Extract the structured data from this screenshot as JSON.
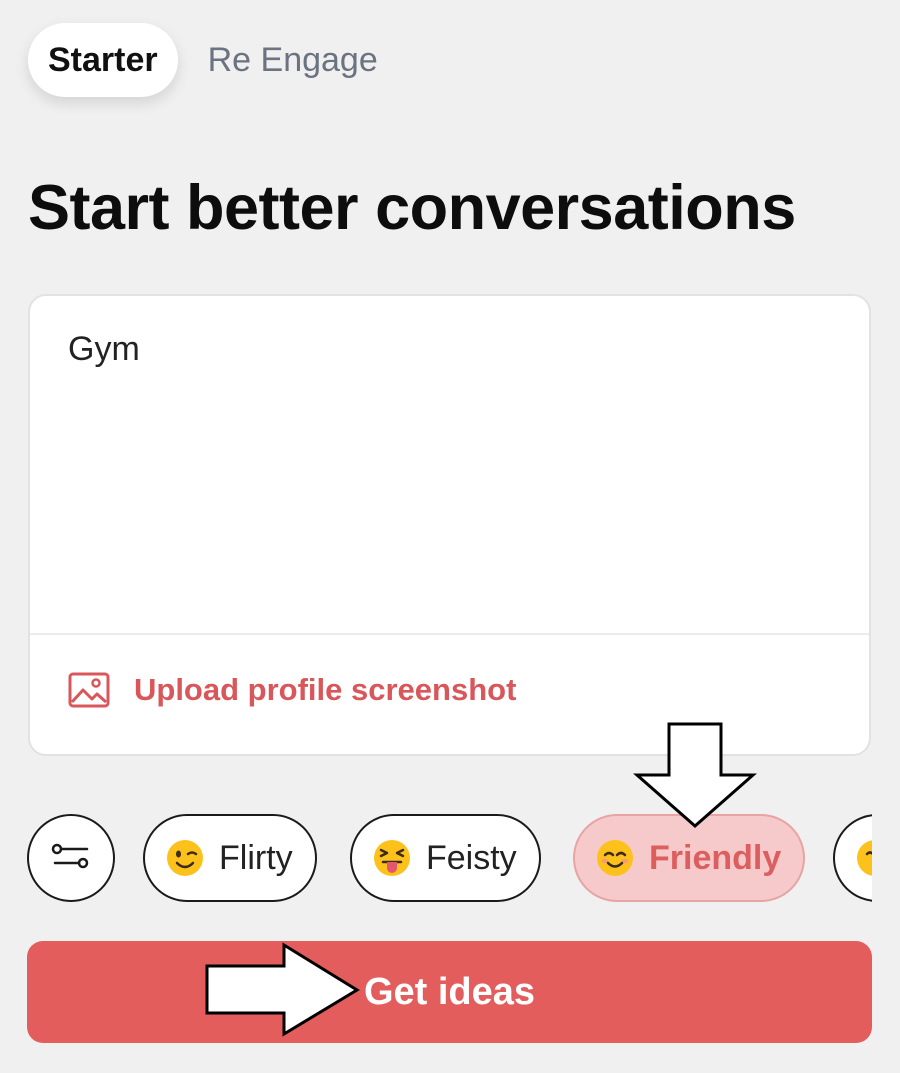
{
  "tabs": [
    {
      "label": "Starter",
      "active": true
    },
    {
      "label": "Re Engage",
      "active": false
    }
  ],
  "heading": "Start better conversations",
  "prompt_input": {
    "value": "Gym"
  },
  "upload": {
    "label": "Upload profile screenshot",
    "icon": "image-icon"
  },
  "filter_button": {
    "icon": "sliders-icon"
  },
  "tone_chips": [
    {
      "label": "Flirty",
      "emoji": "winking-face",
      "selected": false
    },
    {
      "label": "Feisty",
      "emoji": "squinting-face-with-tongue",
      "selected": false
    },
    {
      "label": "Friendly",
      "emoji": "smiling-face-with-smiling-eyes",
      "selected": true
    },
    {
      "label": "",
      "emoji": "partially-visible-face",
      "selected": false
    }
  ],
  "cta": {
    "label": "Get ideas"
  },
  "colors": {
    "accent": "#e35d5d",
    "accent_text": "#d9575a",
    "selected_chip_bg": "#f6caca",
    "background": "#f0f0f0"
  },
  "annotations": [
    {
      "type": "arrow",
      "direction": "down",
      "target": "tone-chip-friendly"
    },
    {
      "type": "arrow",
      "direction": "right",
      "target": "get-ideas-button"
    }
  ]
}
